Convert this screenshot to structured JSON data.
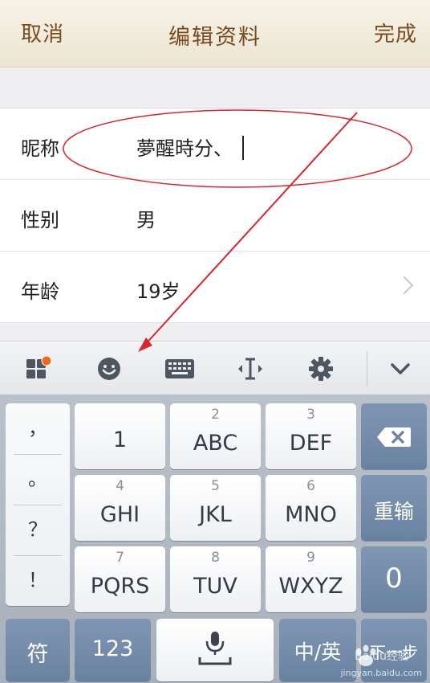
{
  "header": {
    "cancel_label": "取消",
    "title": "编辑资料",
    "done_label": "完成"
  },
  "form": {
    "rows": [
      {
        "label": "昵称",
        "value": "夢醒時分、"
      },
      {
        "label": "性别",
        "value": "男"
      },
      {
        "label": "年龄",
        "value": "19岁"
      }
    ]
  },
  "toolbar": {
    "icons": [
      "apps-icon",
      "emoji-icon",
      "keyboard-icon",
      "cursor-move-icon",
      "settings-icon",
      "chevron-down-icon"
    ],
    "notification_color": "#f26b1d"
  },
  "keyboard": {
    "punctuation": [
      "，",
      "。",
      "？",
      "！"
    ],
    "keys": [
      {
        "num": "",
        "label": "1"
      },
      {
        "num": "2",
        "label": "ABC"
      },
      {
        "num": "3",
        "label": "DEF"
      },
      {
        "num": "4",
        "label": "GHI"
      },
      {
        "num": "5",
        "label": "JKL"
      },
      {
        "num": "6",
        "label": "MNO"
      },
      {
        "num": "7",
        "label": "PQRS"
      },
      {
        "num": "8",
        "label": "TUV"
      },
      {
        "num": "9",
        "label": "WXYZ"
      }
    ],
    "retype_label": "重输",
    "zero_label": "0",
    "symbols_label": "符",
    "numbers_label": "123",
    "lang_label": "中/英",
    "next_label": "下一步"
  },
  "watermark": {
    "brand": "Baidu经验",
    "url": "jingyan.baidu.com"
  },
  "colors": {
    "header_text": "#7a4a1e",
    "annotation_red": "#d8262c",
    "dark_key": "#7289a8"
  }
}
